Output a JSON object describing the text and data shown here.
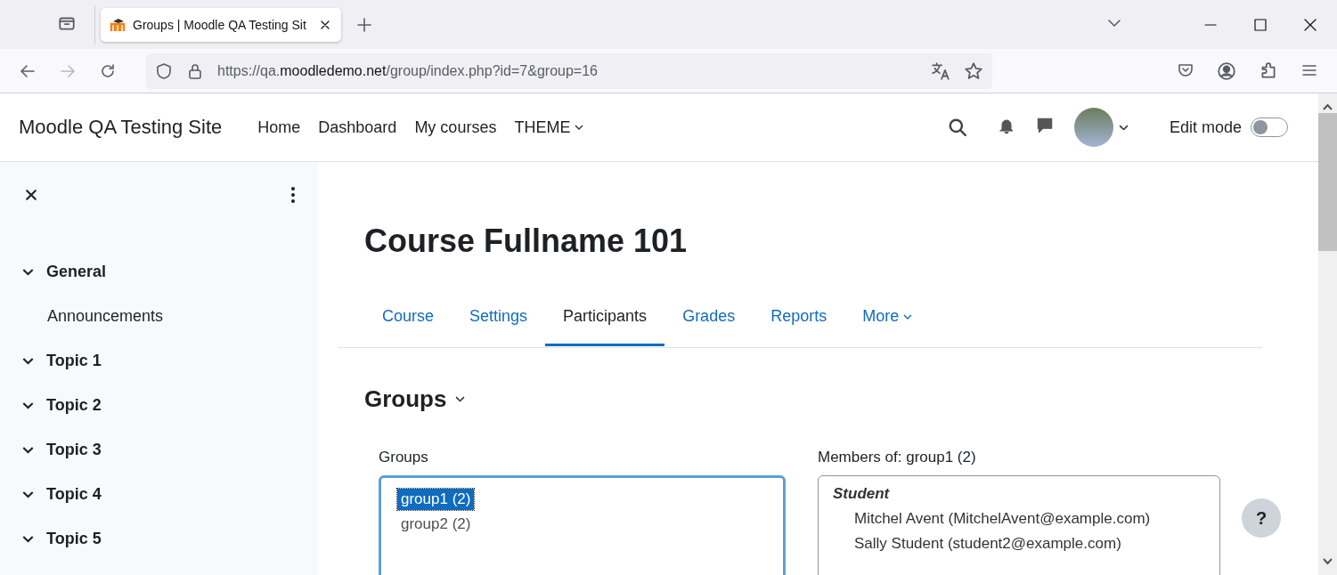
{
  "browser": {
    "tab_title": "Groups | Moodle QA Testing Sit",
    "url": {
      "start": "https://qa.",
      "domain": "moodledemo.net",
      "rest": "/group/index.php?id=7&group=16"
    },
    "forward_disabled": true
  },
  "navbar": {
    "site_name": "Moodle QA Testing Site",
    "links": [
      {
        "label": "Home",
        "dropdown": false
      },
      {
        "label": "Dashboard",
        "dropdown": false
      },
      {
        "label": "My courses",
        "dropdown": false
      },
      {
        "label": "THEME",
        "dropdown": true
      }
    ],
    "edit_mode": {
      "label": "Edit mode",
      "on": false
    }
  },
  "sidebar": {
    "items": [
      {
        "kind": "section",
        "label": "General",
        "expanded": true
      },
      {
        "kind": "item",
        "label": "Announcements"
      },
      {
        "kind": "section",
        "label": "Topic 1",
        "expanded": true
      },
      {
        "kind": "section",
        "label": "Topic 2",
        "expanded": true
      },
      {
        "kind": "section",
        "label": "Topic 3",
        "expanded": true
      },
      {
        "kind": "section",
        "label": "Topic 4",
        "expanded": true
      },
      {
        "kind": "section",
        "label": "Topic 5",
        "expanded": true
      }
    ]
  },
  "course_title": "Course Fullname 101",
  "tabs": [
    {
      "label": "Course",
      "selected": false,
      "dropdown": false
    },
    {
      "label": "Settings",
      "selected": false,
      "dropdown": false
    },
    {
      "label": "Participants",
      "selected": true,
      "dropdown": false
    },
    {
      "label": "Grades",
      "selected": false,
      "dropdown": false
    },
    {
      "label": "Reports",
      "selected": false,
      "dropdown": false
    },
    {
      "label": "More",
      "selected": false,
      "dropdown": true
    }
  ],
  "heading": "Groups",
  "groups": {
    "label": "Groups",
    "options": [
      {
        "label": "group1 (2)",
        "selected": true
      },
      {
        "label": "group2 (2)",
        "selected": false
      }
    ]
  },
  "members": {
    "label": "Members of: group1 (2)",
    "roles": [
      {
        "role": "Student",
        "names": [
          "Mitchel Avent (MitchelAvent@example.com)",
          "Sally Student (student2@example.com)"
        ]
      }
    ]
  },
  "help_button": "?"
}
